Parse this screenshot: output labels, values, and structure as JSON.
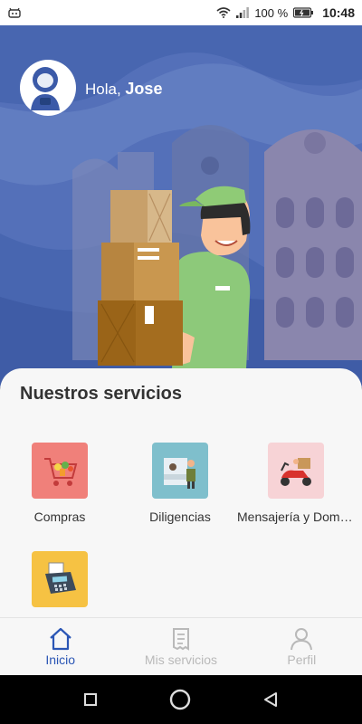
{
  "status_bar": {
    "battery": "100 %",
    "time": "10:48"
  },
  "header": {
    "greeting_prefix": "Hola,",
    "user_name": "Jose"
  },
  "services_section": {
    "title": "Nuestros servicios",
    "items": [
      {
        "label": "Compras",
        "icon": "shopping-cart-icon",
        "color": "#f0807a"
      },
      {
        "label": "Diligencias",
        "icon": "errand-counter-icon",
        "color": "#7fbfcc"
      },
      {
        "label": "Mensajería y Domicilios",
        "icon": "delivery-scooter-icon",
        "color": "#f7d3d6"
      },
      {
        "label": "",
        "icon": "payment-terminal-icon",
        "color": "#f6c243"
      }
    ]
  },
  "bottom_nav": {
    "items": [
      {
        "label": "Inicio",
        "icon": "home-icon",
        "active": true
      },
      {
        "label": "Mis servicios",
        "icon": "receipt-icon",
        "active": false
      },
      {
        "label": "Perfil",
        "icon": "user-icon",
        "active": false
      }
    ]
  },
  "colors": {
    "hero_blue": "#5470b9",
    "primary": "#2b56b5",
    "inactive": "#b9b9b9"
  }
}
